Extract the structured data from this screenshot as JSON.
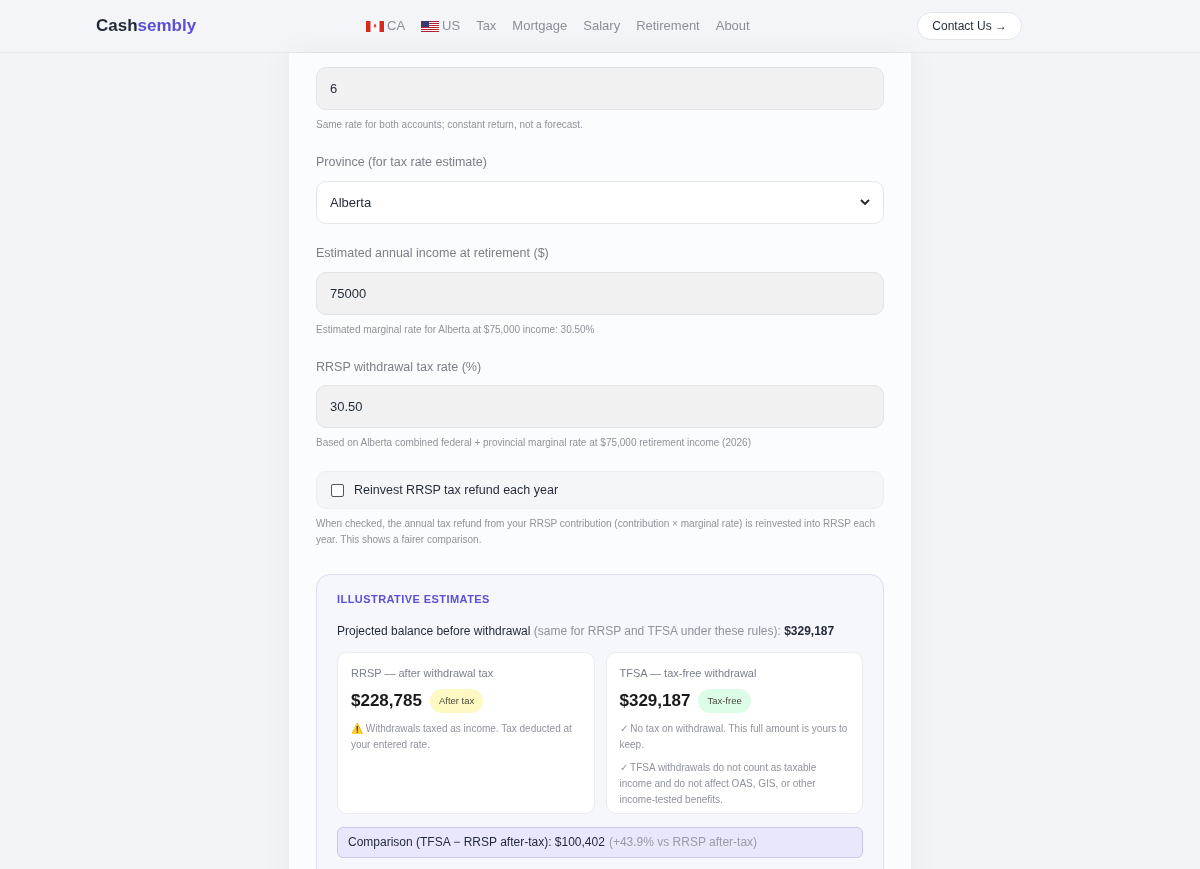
{
  "header": {
    "logo_primary": "Cash",
    "logo_accent": "sembly",
    "nav": [
      {
        "label": "CA",
        "kind": "ca_flag"
      },
      {
        "label": "US",
        "kind": "us_flag"
      },
      {
        "label": "Tax",
        "kind": "link"
      },
      {
        "label": "Mortgage",
        "kind": "link"
      },
      {
        "label": "Salary",
        "kind": "link"
      },
      {
        "label": "Retirement",
        "kind": "link"
      },
      {
        "label": "About",
        "kind": "link"
      }
    ],
    "contact_button": "Contact Us →"
  },
  "form": {
    "fields": [
      {
        "kind": "input",
        "value": "6",
        "hint": "Same rate for both accounts; constant return, not a forecast."
      },
      {
        "kind": "select",
        "label": "Province (for tax rate estimate)",
        "value": "Alberta"
      },
      {
        "kind": "input",
        "label": "Estimated annual income at retirement ($)",
        "value": "75000",
        "hint": "Estimated marginal rate for Alberta at $75,000 income: 30.50%"
      },
      {
        "kind": "input",
        "label": "RRSP withdrawal tax rate (%)",
        "value": "30.50",
        "hint": "Based on Alberta combined federal + provincial marginal rate at $75,000 retirement income (2026)"
      },
      {
        "kind": "checkbox",
        "label": "Reinvest RRSP tax refund each year",
        "checked": false,
        "hint": "When checked, the annual tax refund from your RRSP contribution (contribution × marginal rate) is reinvested into RRSP each year. This shows a fairer comparison."
      }
    ]
  },
  "results": {
    "heading": "ILLUSTRATIVE ESTIMATES",
    "projected_label": "Projected balance before withdrawal",
    "projected_note": "(same for RRSP and TFSA under these rules):",
    "projected_value": "$329,187",
    "cards": [
      {
        "title": "RRSP — after withdrawal tax",
        "amount": "$228,785",
        "badge": "After tax",
        "color": "#fef9c3",
        "notes": [
          "⚠️ Withdrawals taxed as income. Tax deducted at your entered rate."
        ]
      },
      {
        "title": "TFSA — tax-free withdrawal",
        "amount": "$329,187",
        "badge": "Tax-free",
        "color": "#dcfce7",
        "notes": [
          "✓ No tax on withdrawal. This full amount is yours to keep.",
          "✓ TFSA withdrawals do not count as taxable income and do not affect OAS, GIS, or other income-tested benefits."
        ]
      }
    ],
    "comparison_label": "Comparison (TFSA − RRSP after-tax): $100,402",
    "comparison_note": "(+43.9% vs RRSP after-tax)"
  }
}
